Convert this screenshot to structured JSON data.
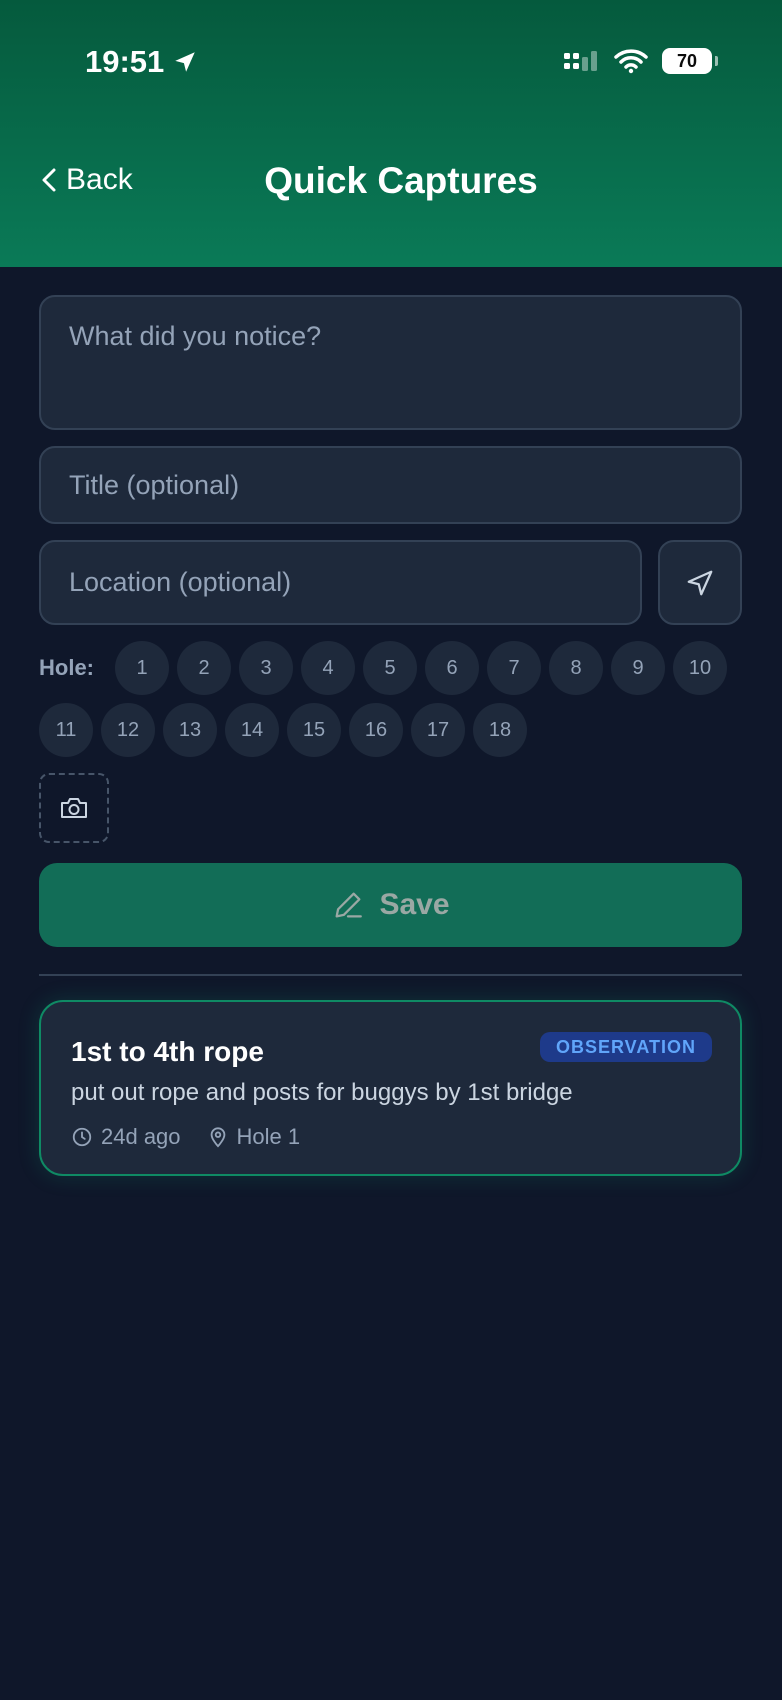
{
  "status_bar": {
    "time": "19:51",
    "battery": "70"
  },
  "nav": {
    "back_label": "Back",
    "title": "Quick Captures"
  },
  "form": {
    "notice_placeholder": "What did you notice?",
    "title_placeholder": "Title (optional)",
    "location_placeholder": "Location (optional)",
    "hole_label": "Hole:",
    "holes": [
      "1",
      "2",
      "3",
      "4",
      "5",
      "6",
      "7",
      "8",
      "9",
      "10",
      "11",
      "12",
      "13",
      "14",
      "15",
      "16",
      "17",
      "18"
    ],
    "save_label": "Save"
  },
  "captures": [
    {
      "title": "1st to 4th rope",
      "badge": "OBSERVATION",
      "description": "put out rope and posts for buggys by 1st bridge",
      "time_ago": "24d ago",
      "hole": "Hole 1"
    }
  ],
  "colors": {
    "accent": "#126d57",
    "header": "#0a7a57",
    "background": "#0f172a",
    "badge_text": "#60a5fa"
  }
}
